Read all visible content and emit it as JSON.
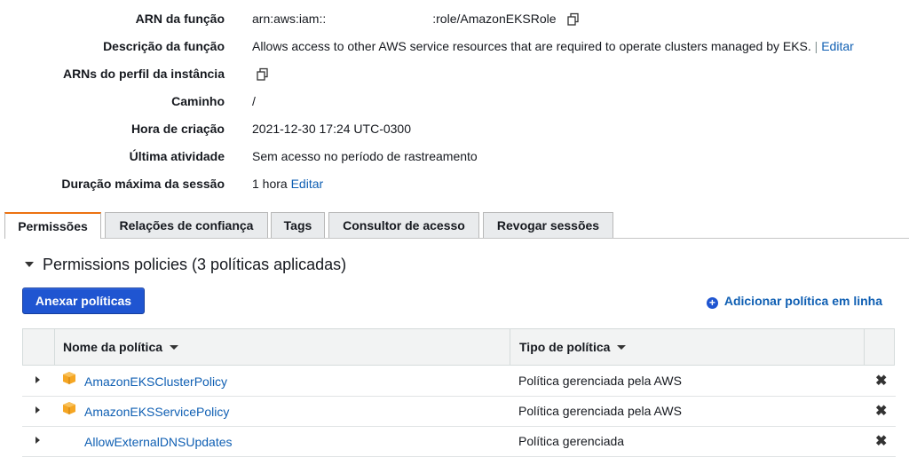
{
  "summary": {
    "arn": {
      "label": "ARN da função",
      "value_prefix": "arn:aws:iam::",
      "value_suffix": ":role/AmazonEKSRole"
    },
    "description": {
      "label": "Descrição da função",
      "value": "Allows access to other AWS service resources that are required to operate clusters managed by EKS.",
      "separator": "|",
      "edit": "Editar"
    },
    "instance_profile": {
      "label": "ARNs do perfil da instância"
    },
    "path": {
      "label": "Caminho",
      "value": "/"
    },
    "created": {
      "label": "Hora de criação",
      "value": "2021-12-30 17:24 UTC-0300"
    },
    "last_activity": {
      "label": "Última atividade",
      "value": "Sem acesso no período de rastreamento"
    },
    "max_session": {
      "label": "Duração máxima da sessão",
      "value": "1 hora",
      "edit": "Editar"
    }
  },
  "tabs": [
    {
      "label": "Permissões",
      "active": true
    },
    {
      "label": "Relações de confiança"
    },
    {
      "label": "Tags"
    },
    {
      "label": "Consultor de acesso"
    },
    {
      "label": "Revogar sessões"
    }
  ],
  "permissions": {
    "section_title": "Permissions policies (3 políticas aplicadas)",
    "attach_button": "Anexar políticas",
    "add_inline": "Adicionar política em linha",
    "columns": {
      "name": "Nome da política",
      "type": "Tipo de política"
    },
    "rows": [
      {
        "name": "AmazonEKSClusterPolicy",
        "type": "Política gerenciada pela AWS",
        "aws_icon": true
      },
      {
        "name": "AmazonEKSServicePolicy",
        "type": "Política gerenciada pela AWS",
        "aws_icon": true
      },
      {
        "name": "AllowExternalDNSUpdates",
        "type": "Política gerenciada",
        "aws_icon": false
      }
    ]
  },
  "colors": {
    "accent": "#ec7211",
    "link": "#0f5fb3",
    "primary_button": "#1f55d1"
  },
  "icons": {
    "copy": "copy-icon",
    "remove": "close-icon",
    "aws_managed": "aws-cube-icon",
    "add": "plus-circle-icon"
  }
}
